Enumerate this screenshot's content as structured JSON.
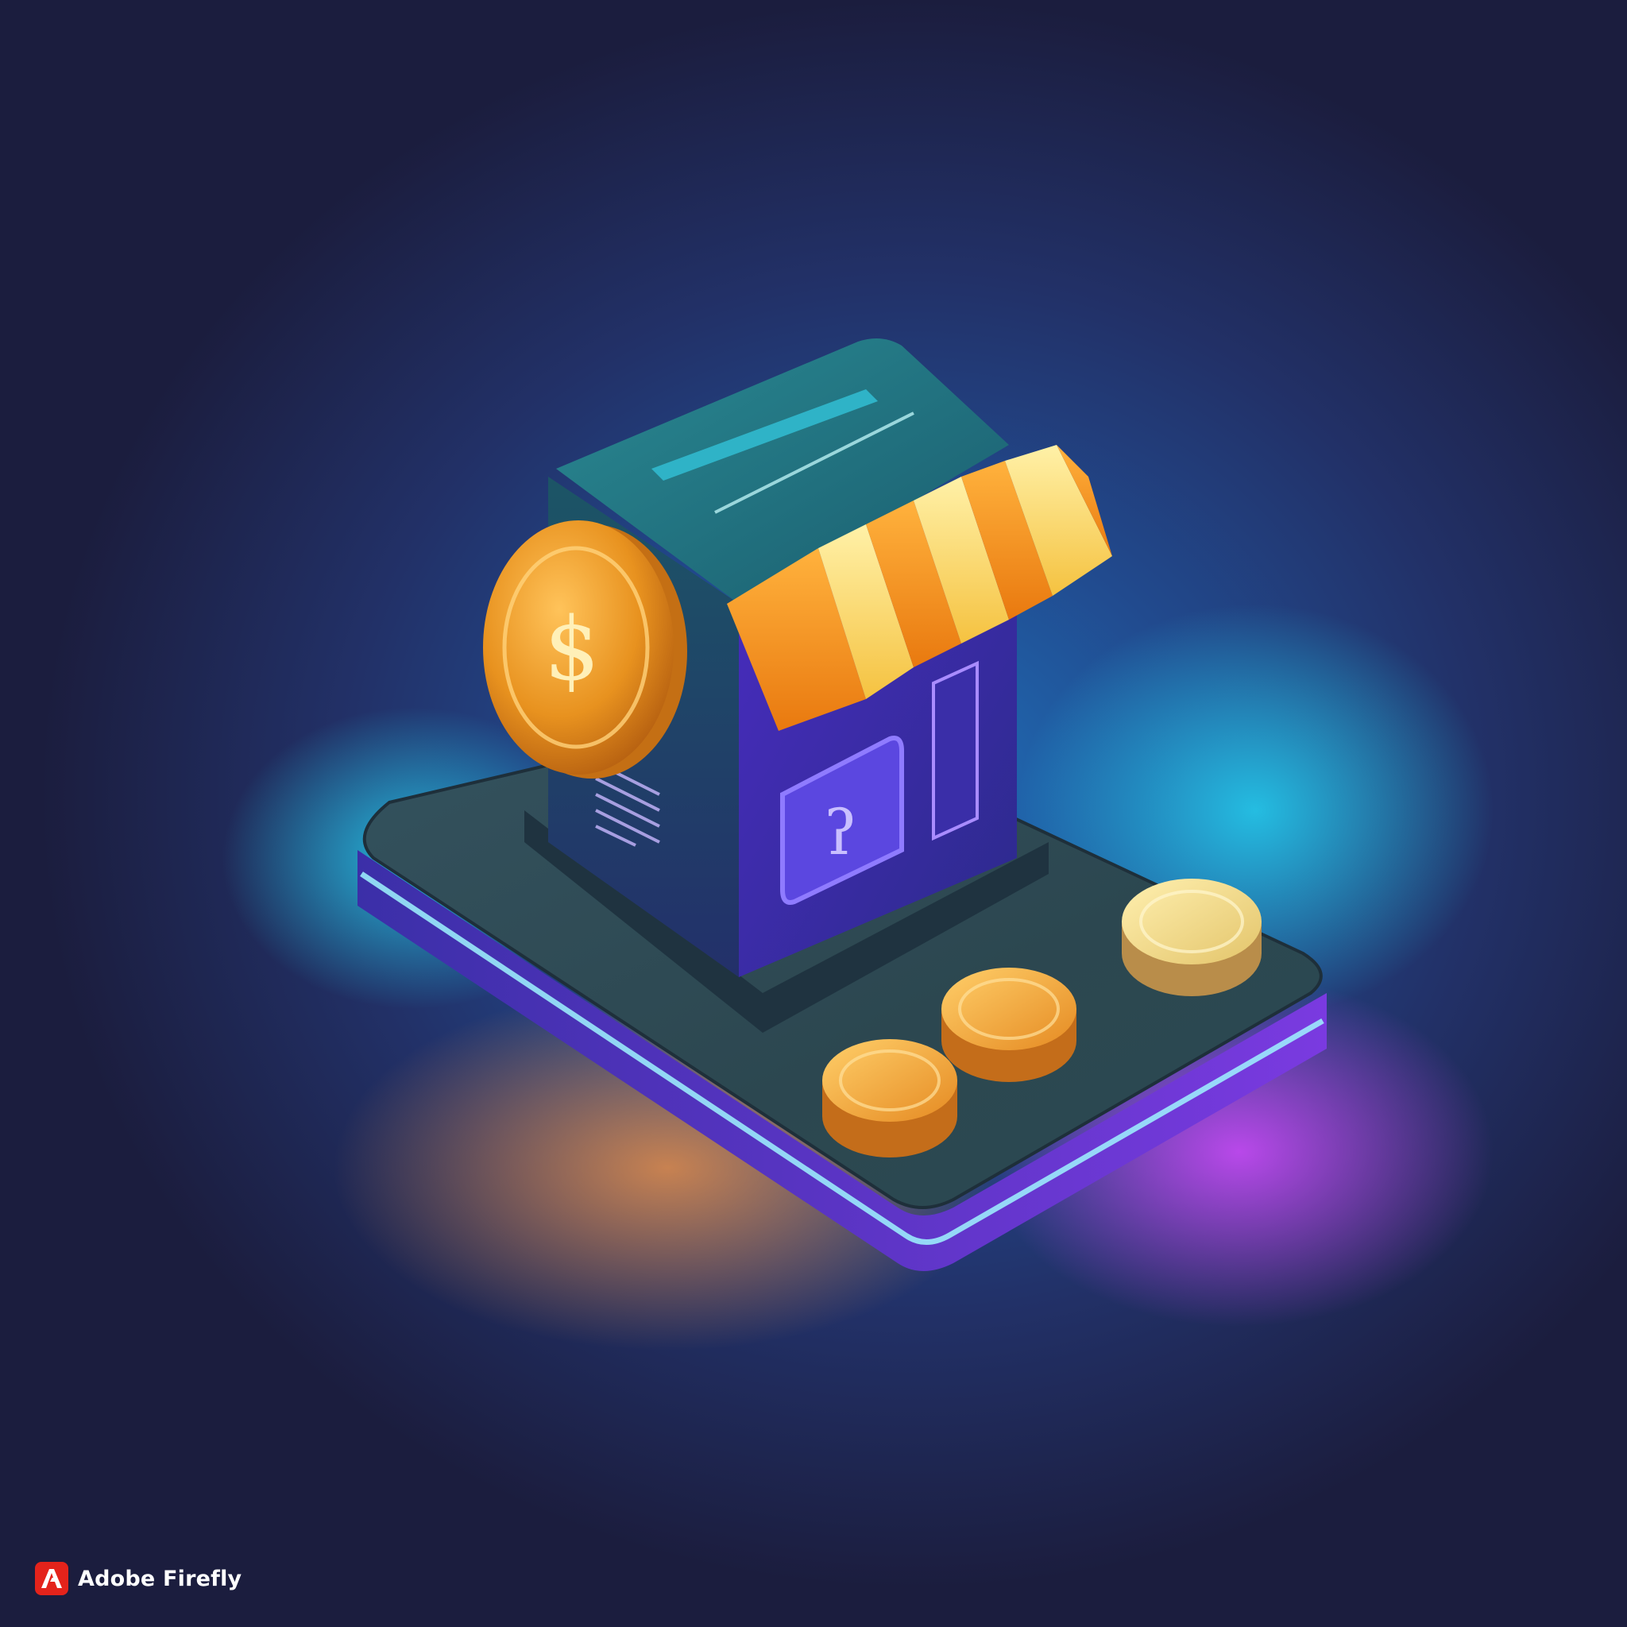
{
  "watermark": {
    "text": "Adobe Firefly",
    "icon": "adobe-logo-icon"
  },
  "illustration": {
    "subject": "isometric shop with coin",
    "coin_symbol": "$",
    "colors": {
      "background_dark": "#1b1d3e",
      "background_glow": "#1f6fb8",
      "platform_top": "#2f4a55",
      "platform_edge": "#5a2fd6",
      "glow_cyan": "#22d8ff",
      "glow_magenta": "#d14bff",
      "glow_orange": "#ff8a3d",
      "shop_teal": "#1d6f7a",
      "shop_purple": "#4a2fc4",
      "awning_yellow": "#f7d35a",
      "awning_orange": "#f28c1c",
      "coin_gold": "#e39a25"
    }
  }
}
